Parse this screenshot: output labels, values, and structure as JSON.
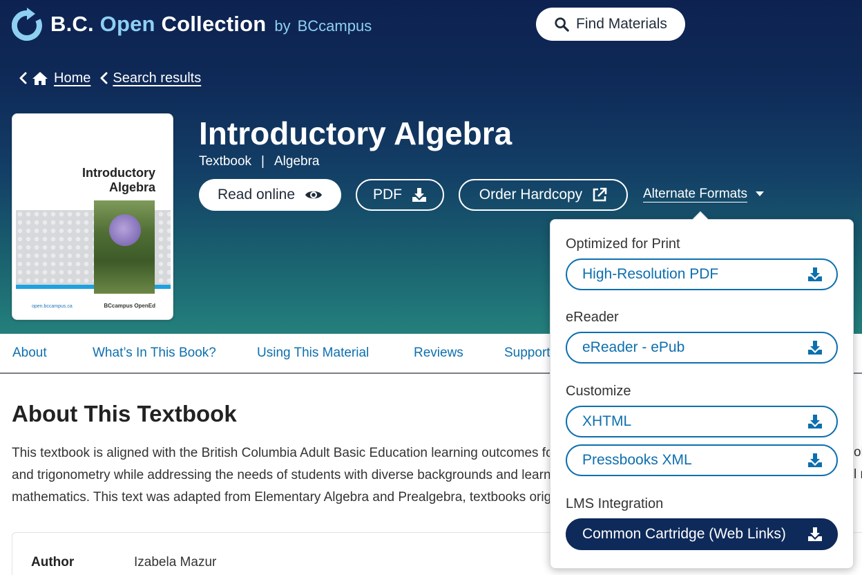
{
  "header": {
    "logo_bc": "B.C.",
    "logo_open": "Open",
    "logo_collection": "Collection",
    "logo_by": "by",
    "logo_brand": "BCcampus",
    "find_label": "Find Materials"
  },
  "breadcrumb": {
    "home": "Home",
    "search": "Search results"
  },
  "cover": {
    "title_line1": "Introductory",
    "title_line2": "Algebra",
    "footer_left": "open.bccampus.ca",
    "footer_right": "BCcampus OpenEd"
  },
  "book": {
    "title": "Introductory Algebra",
    "type": "Textbook",
    "separator": "|",
    "subject": "Algebra"
  },
  "actions": {
    "read_online": "Read online",
    "pdf": "PDF",
    "order_hardcopy": "Order Hardcopy",
    "alternate_formats": "Alternate Formats"
  },
  "tabs": [
    "About",
    "What’s In This Book?",
    "Using This Material",
    "Reviews",
    "Support"
  ],
  "about": {
    "heading": "About This Textbook",
    "lines": [
      "This textbook is aligned with the British Columbia Adult Basic Education learning outcomes for",
      "and trigonometry while addressing the needs of students with diverse backgrounds and learnir",
      "mathematics. This text was adapted from Elementary Algebra and Prealgebra, textbooks origina"
    ],
    "right_fragments": [
      "ok",
      "l r"
    ]
  },
  "info": {
    "author_label": "Author",
    "author_value": "Izabela Mazur"
  },
  "dropdown": {
    "groups": [
      {
        "heading": "Optimized for Print",
        "items": [
          "High-Resolution PDF"
        ]
      },
      {
        "heading": "eReader",
        "items": [
          "eReader - ePub"
        ]
      },
      {
        "heading": "Customize",
        "items": [
          "XHTML",
          "Pressbooks XML"
        ]
      },
      {
        "heading": "LMS Integration",
        "items": [
          "Common Cartridge (Web Links)"
        ]
      }
    ]
  },
  "colors": {
    "header_dark": "#0d2250",
    "header_teal": "#24807c",
    "link_blue": "#0d6fae",
    "logo_accent": "#8ed0f2",
    "solid_button": "#0e2a5a"
  },
  "icons": {
    "logo": "refresh-circle-icon",
    "search": "search-icon",
    "home": "home-icon",
    "chevron": "chevron-left-icon",
    "eye": "eye-icon",
    "download": "download-icon",
    "external": "external-link-icon",
    "caret": "caret-down-icon"
  }
}
